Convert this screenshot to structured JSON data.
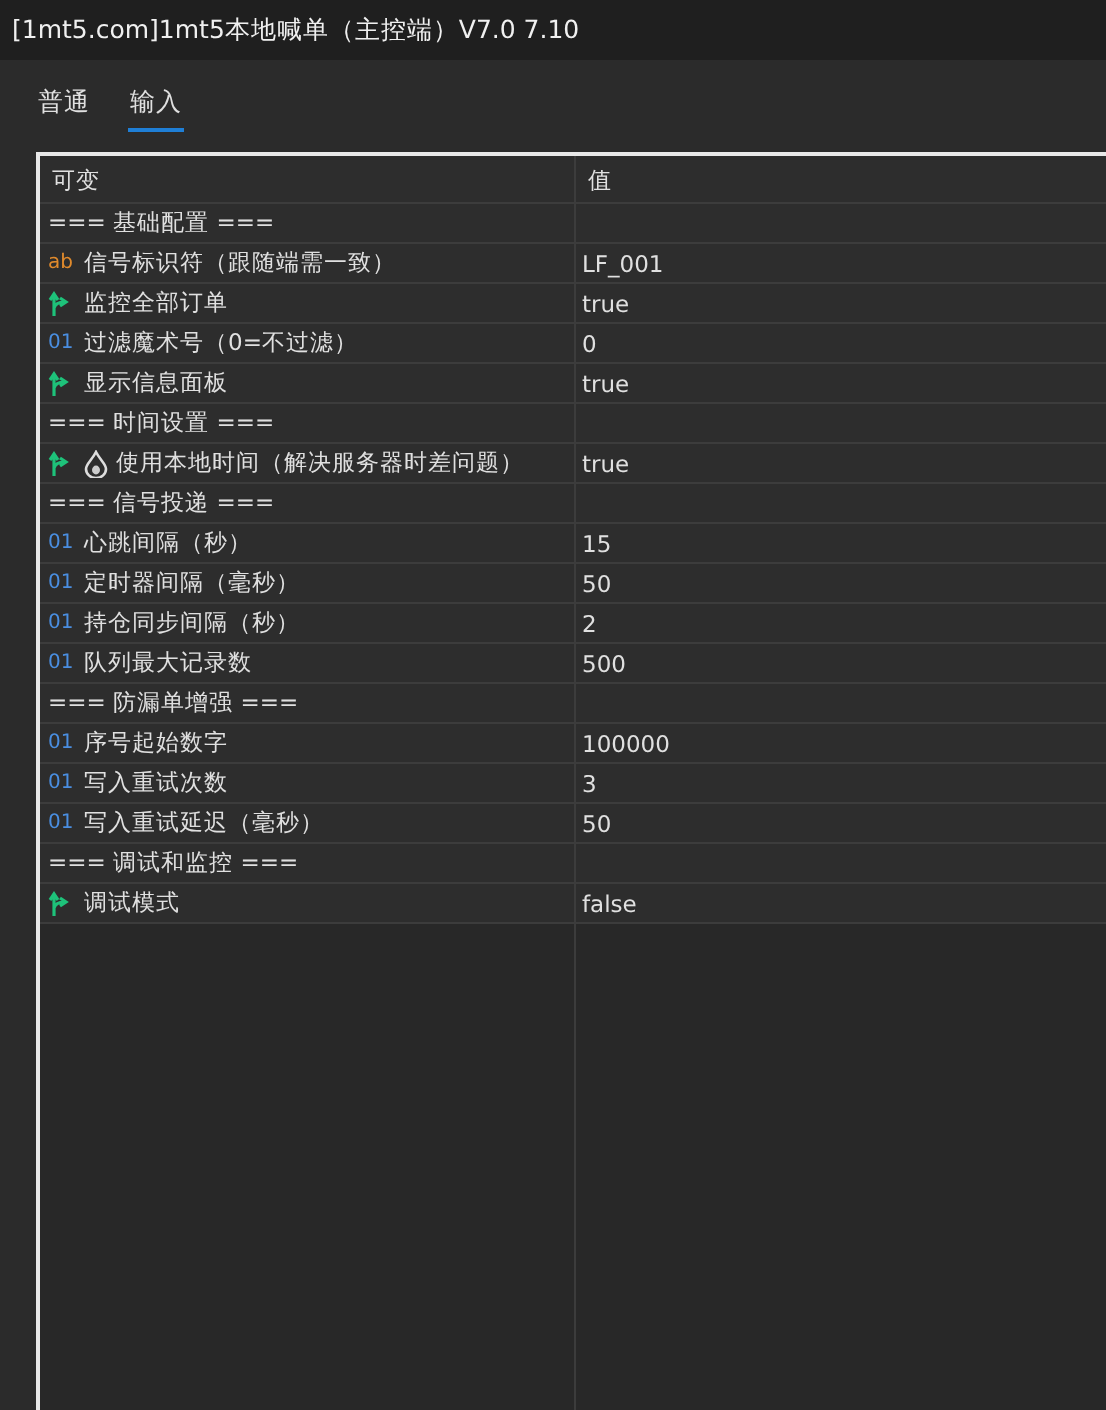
{
  "window": {
    "title": "[1mt5.com]1mt5本地喊单（主控端）V7.0 7.10"
  },
  "tabs": [
    {
      "label": "普通",
      "selected": false
    },
    {
      "label": "输入",
      "selected": true
    }
  ],
  "table": {
    "columns": [
      "可变",
      "值"
    ],
    "rows": [
      {
        "kind": "section",
        "name": "=== 基础配置 ==="
      },
      {
        "kind": "string",
        "name": "信号标识符（跟随端需一致）",
        "type_text": "ab",
        "value": "LF_001",
        "drop_icon": false
      },
      {
        "kind": "bool",
        "name": "监控全部订单",
        "value": "true",
        "drop_icon": false
      },
      {
        "kind": "int",
        "name": "过滤魔术号（0=不过滤）",
        "type_text": "01",
        "value": "0",
        "drop_icon": false
      },
      {
        "kind": "bool",
        "name": "显示信息面板",
        "value": "true",
        "drop_icon": false
      },
      {
        "kind": "section",
        "name": "=== 时间设置 ==="
      },
      {
        "kind": "bool",
        "name": "使用本地时间（解决服务器时差问题）",
        "value": "true",
        "drop_icon": true
      },
      {
        "kind": "section",
        "name": "=== 信号投递 ==="
      },
      {
        "kind": "int",
        "name": "心跳间隔（秒）",
        "type_text": "01",
        "value": "15",
        "drop_icon": false
      },
      {
        "kind": "int",
        "name": "定时器间隔（毫秒）",
        "type_text": "01",
        "value": "50",
        "drop_icon": false
      },
      {
        "kind": "int",
        "name": "持仓同步间隔（秒）",
        "type_text": "01",
        "value": "2",
        "drop_icon": false
      },
      {
        "kind": "int",
        "name": "队列最大记录数",
        "type_text": "01",
        "value": "500",
        "drop_icon": false
      },
      {
        "kind": "section",
        "name": "=== 防漏单增强 ==="
      },
      {
        "kind": "int",
        "name": "序号起始数字",
        "type_text": "01",
        "value": "100000",
        "drop_icon": false
      },
      {
        "kind": "int",
        "name": "写入重试次数",
        "type_text": "01",
        "value": "3",
        "drop_icon": false
      },
      {
        "kind": "int",
        "name": "写入重试延迟（毫秒）",
        "type_text": "01",
        "value": "50",
        "drop_icon": false
      },
      {
        "kind": "section",
        "name": "=== 调试和监控 ==="
      },
      {
        "kind": "bool",
        "name": "调试模式",
        "value": "false",
        "drop_icon": false
      }
    ]
  }
}
